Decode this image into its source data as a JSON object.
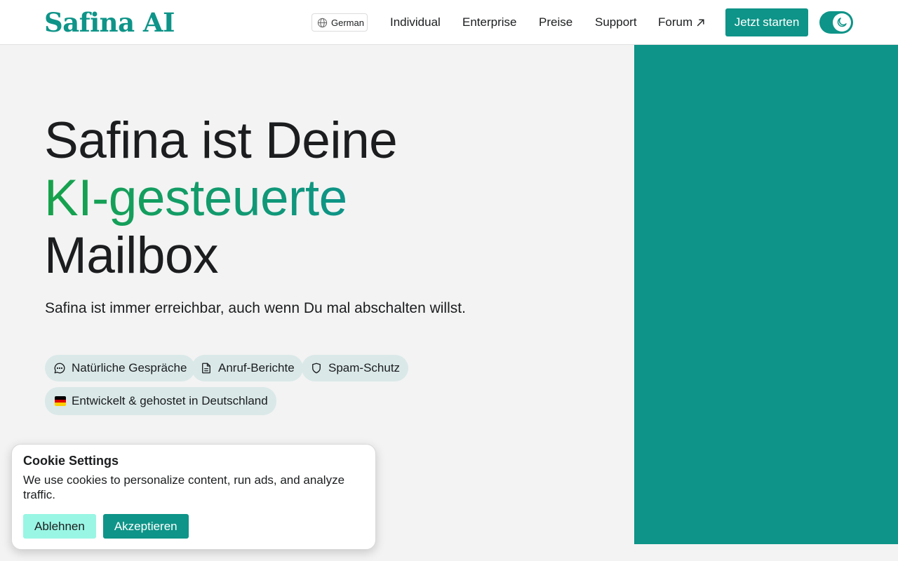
{
  "header": {
    "logo": "Safina AI",
    "language": "German",
    "nav": {
      "individual": "Individual",
      "enterprise": "Enterprise",
      "pricing": "Preise",
      "support": "Support",
      "forum": "Forum"
    },
    "cta": "Jetzt starten",
    "theme_toggle_icon": "moon-icon"
  },
  "hero": {
    "title_line1": "Safina ist Deine",
    "title_line2": "KI-gesteuerte",
    "title_line3": "Mailbox",
    "subtitle": "Safina ist immer erreichbar, auch wenn Du mal abschalten willst.",
    "features": [
      {
        "label": "Natürliche Gespräche",
        "icon": "chat-bubble-icon"
      },
      {
        "label": "Anruf-Berichte",
        "icon": "document-icon"
      },
      {
        "label": "Spam-Schutz",
        "icon": "shield-icon"
      },
      {
        "label": "Entwickelt & gehostet in Deutschland",
        "icon": "german-flag-icon"
      }
    ]
  },
  "cookie_banner": {
    "title": "Cookie Settings",
    "text": "We use cookies to personalize content, run ads, and analyze traffic.",
    "decline": "Ablehnen",
    "accept": "Akzeptieren"
  },
  "colors": {
    "brand": "#0e9488",
    "gradient_start": "#16a34a",
    "pill_bg": "#dae8e8",
    "decline_bg": "#99f6e4"
  }
}
